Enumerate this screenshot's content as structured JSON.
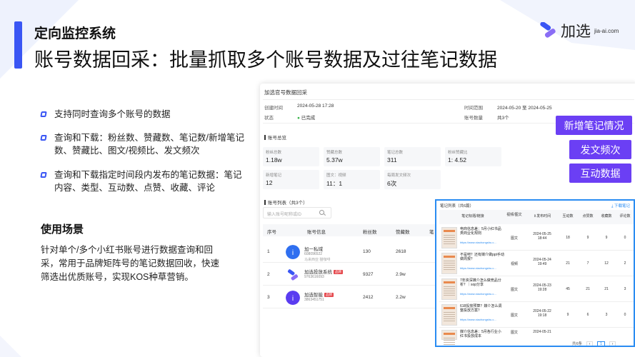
{
  "slide": {
    "section": "定向监控系统",
    "title": "账号数据回采：批量抓取多个账号数据及过往笔记数据"
  },
  "logo": {
    "text": "加选",
    "domain": "jia-ai.com",
    "icon": "jia-ai-logo-icon",
    "color": "#3a56f4"
  },
  "bullets": [
    "支持同时查询多个账号的数据",
    "查询和下载：粉丝数、赞藏数、笔记数/新增笔记数、赞藏比、图文/视频比、发文频次",
    "查询和下载指定时间段内发布的笔记数据：笔记内容、类型、互动数、点赞、收藏、评论"
  ],
  "scenario": {
    "title": "使用场景",
    "body": "针对单个/多个小红书账号进行数据查询和回采，常用于品牌矩阵号的笔记数据回收，快速筛选出优质账号，实现KOS种草营销。"
  },
  "main": {
    "title": "加选官号数据回采",
    "created_label": "创建时间",
    "created_value": "2024-05-28 17:28",
    "status_label": "状态",
    "status_value": "已完成",
    "range_label": "时间范围",
    "range_value": "2024-05-20 至 2024-05-25",
    "count_label": "账号数量",
    "count_value": "共3个",
    "overview_title": "账号总览",
    "stats": [
      {
        "label": "粉丝总数",
        "value": "1.18w"
      },
      {
        "label": "赞藏总数",
        "value": "5.37w"
      },
      {
        "label": "笔记总数",
        "value": "311"
      },
      {
        "label": "粉丝赞藏比",
        "value": "1: 4.52"
      },
      {
        "label": "新增笔记",
        "value": "12"
      },
      {
        "label": "图文：视频",
        "value": "11：1"
      },
      {
        "label": "每周发文频次",
        "value": "6次"
      }
    ],
    "list_title": "账号列表（共3个）",
    "search_placeholder": "输入账号昵称或ID",
    "headers": {
      "index": "序号",
      "info": "账号信息",
      "fans": "粉丝数",
      "likes": "赞藏数",
      "notes": "笔"
    },
    "rows": [
      {
        "index": "1",
        "name": "加一私域",
        "id": "608096522",
        "tags": "马来西亚  猫咖啡",
        "fans": "130",
        "likes": "2618",
        "tag": ""
      },
      {
        "index": "2",
        "name": "加选投放系统",
        "id": "9763616093",
        "tags": "",
        "fans": "9327",
        "likes": "2.9w",
        "tag": "品牌"
      },
      {
        "index": "3",
        "name": "加选智能",
        "id": "3863451751",
        "tags": "",
        "fans": "2412",
        "likes": "2.2w",
        "tag": "品牌"
      }
    ]
  },
  "actions": [
    "新增笔记情况",
    "发文频次",
    "互动数据"
  ],
  "overlay": {
    "title": "笔记列表（共6篇）",
    "download": "下载笔记",
    "headers": [
      "笔记标题/链接",
      "视频/图文",
      "发布时间",
      "互动数",
      "点赞数",
      "收藏数",
      "评论数"
    ],
    "rows": [
      {
        "title": "电商信息差：5月小红书品类商业化规则",
        "link": "https://www.xiaohongshu.c...",
        "type": "图文",
        "date": "2024-05-25",
        "time": "18:44",
        "inter": "18",
        "like": "9",
        "fav": "9",
        "com": "0"
      },
      {
        "title": "不是吧？还有媒介做ppt手动做周报？",
        "link": "https://www.xiaohongshu.c...",
        "type": "视频",
        "date": "2024-05-24",
        "time": "19:49",
        "inter": "21",
        "like": "7",
        "fav": "12",
        "com": "2"
      },
      {
        "title": "7年资深媒介怎么做竞品分析？｜sop分享",
        "link": "https://www.xiaohongshu.c...",
        "type": "图文",
        "date": "2024-05-23",
        "time": "19:28",
        "inter": "45",
        "like": "21",
        "fav": "21",
        "com": "3"
      },
      {
        "title": "618投放预算？媒介怎么调整投放方案？",
        "link": "https://www.xiaohongshu.c...",
        "type": "图文",
        "date": "2024-05-22",
        "time": "19:18",
        "inter": "9",
        "like": "6",
        "fav": "3",
        "com": "0"
      },
      {
        "title": "媒介信息差：5月各行业小红书投放成本",
        "link": "https://www.xiaohongshu.c...",
        "type": "图文",
        "date": "2024-05-21",
        "time": "",
        "inter": "",
        "like": "",
        "fav": "",
        "com": ""
      }
    ],
    "pagination": {
      "total": "共6条",
      "prev": "‹",
      "page": "1",
      "next": "›"
    }
  }
}
